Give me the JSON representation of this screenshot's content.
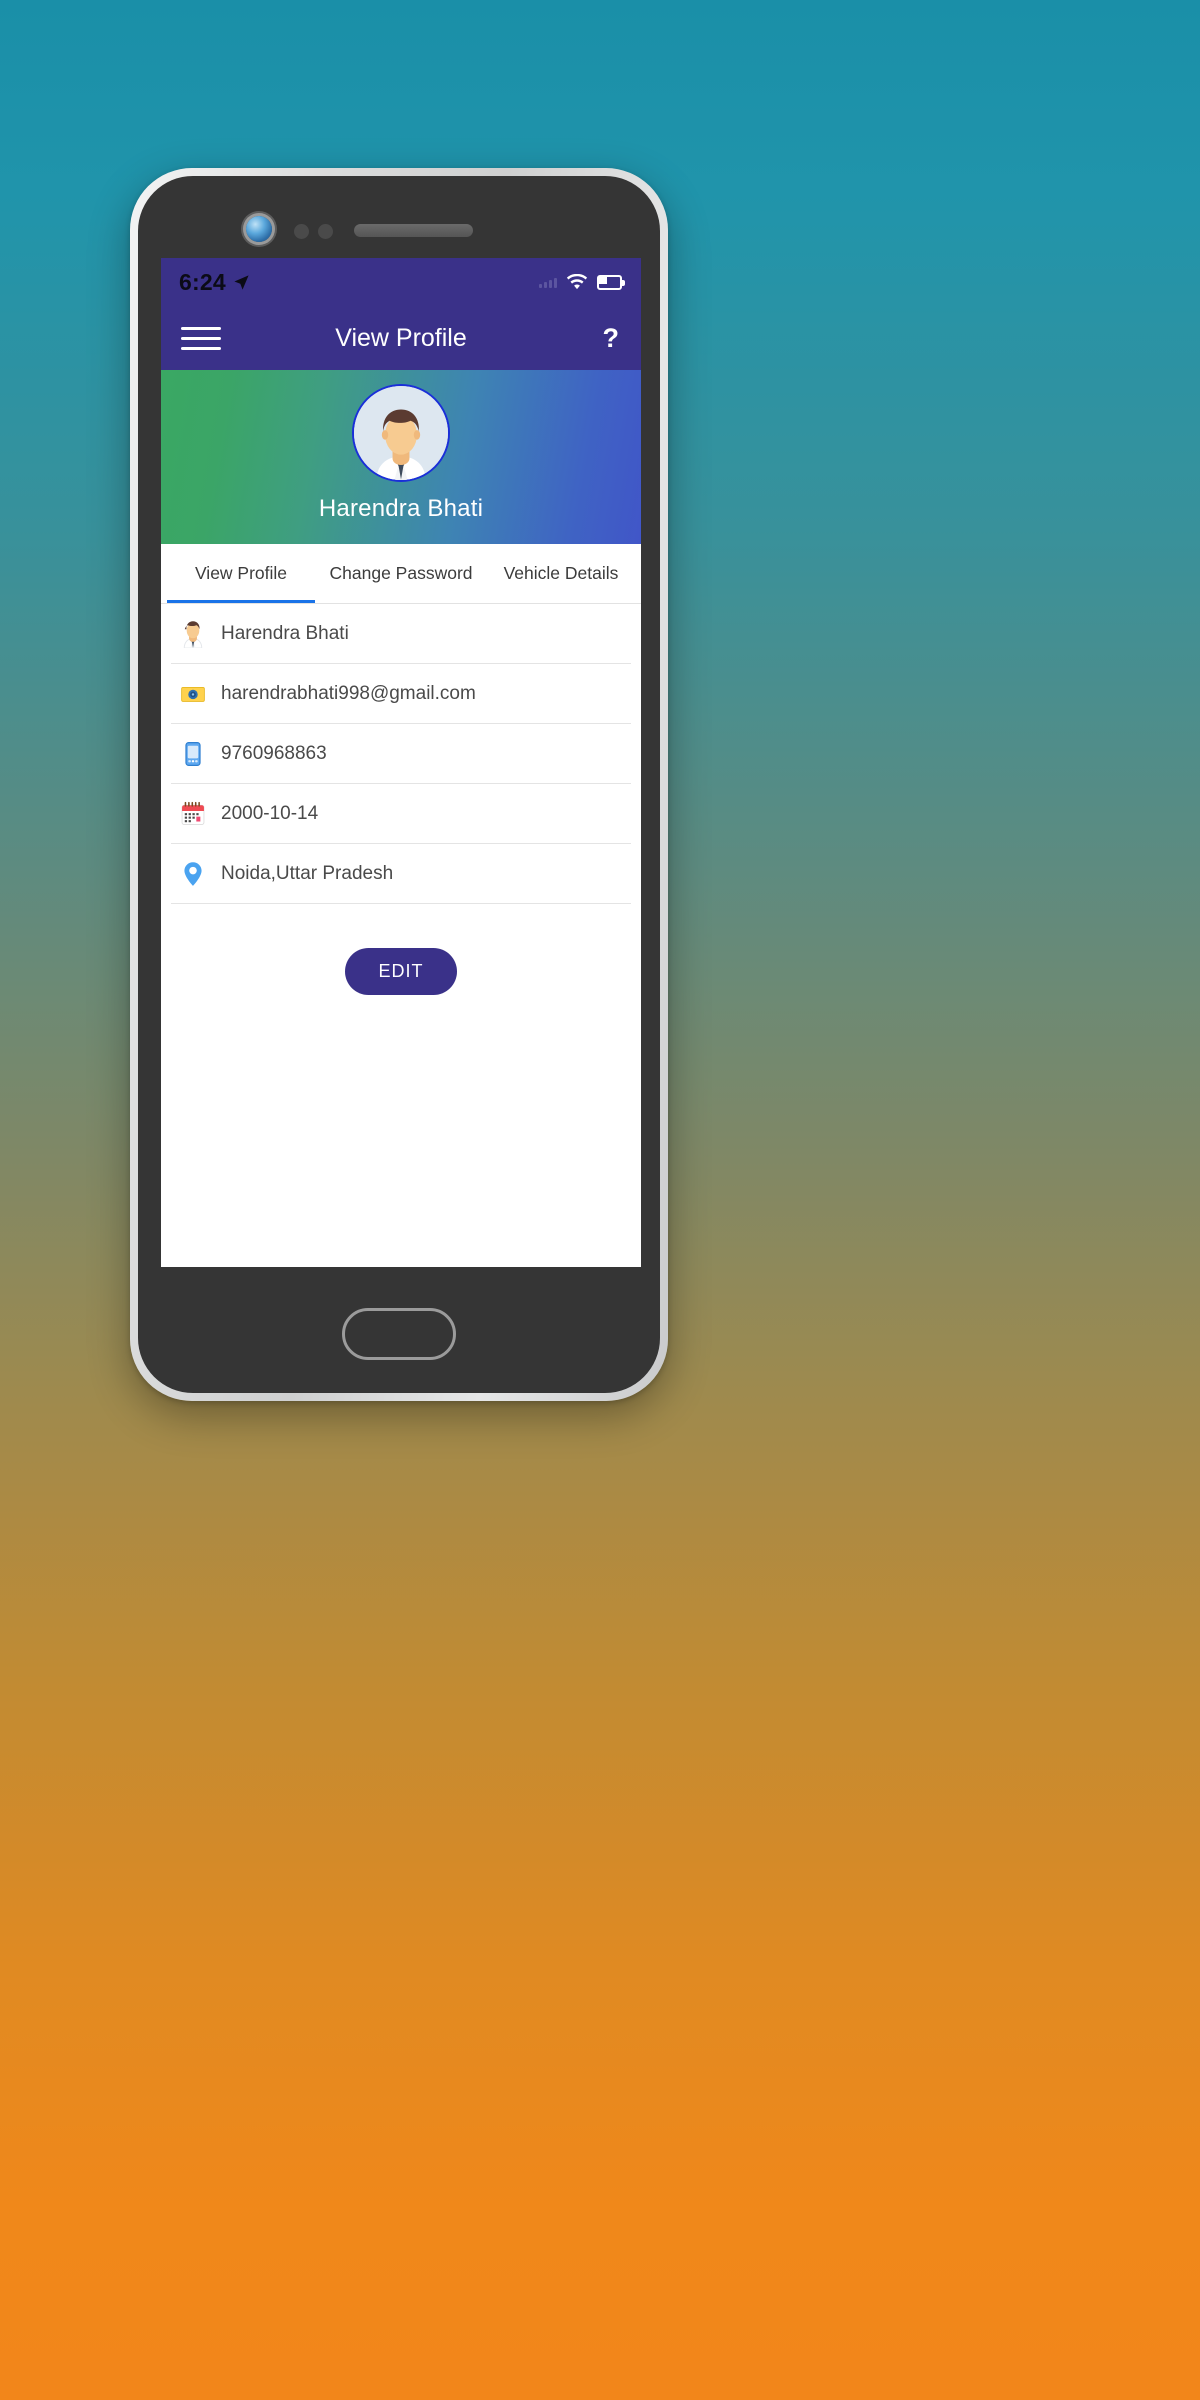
{
  "status_bar": {
    "time": "6:24",
    "location_icon": "location-arrow-icon",
    "signal_icon": "signal-dots-icon",
    "wifi_icon": "wifi-icon",
    "battery_icon": "battery-icon"
  },
  "app_bar": {
    "menu_icon": "hamburger-menu-icon",
    "title": "View Profile",
    "help_label": "?"
  },
  "banner": {
    "avatar_icon": "user-avatar-icon",
    "name": "Harendra Bhati"
  },
  "tabs": [
    {
      "label": "View Profile",
      "active": true
    },
    {
      "label": "Change Password",
      "active": false
    },
    {
      "label": "Vehicle Details",
      "active": false
    }
  ],
  "profile_fields": [
    {
      "icon": "person-icon",
      "value": "Harendra Bhati"
    },
    {
      "icon": "email-icon",
      "value": "harendrabhati998@gmail.com"
    },
    {
      "icon": "phone-icon",
      "value": "9760968863"
    },
    {
      "icon": "calendar-icon",
      "value": "2000-10-14"
    },
    {
      "icon": "location-pin-icon",
      "value": "Noida,Uttar Pradesh"
    }
  ],
  "actions": {
    "edit_label": "EDIT"
  },
  "colors": {
    "primary_purple": "#3A3189",
    "tab_indicator_blue": "#1A73E8",
    "banner_green": "#3AA863",
    "banner_blue": "#4156C8",
    "avatar_border": "#1A2FD8"
  }
}
